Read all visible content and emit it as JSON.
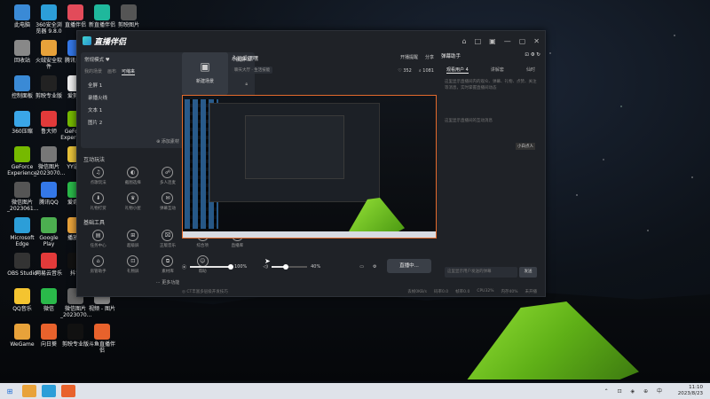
{
  "desktop": {
    "icons": [
      {
        "label": "此电脑",
        "color": "#3a8ad6"
      },
      {
        "label": "360安全浏览器 9.8.0",
        "color": "#2c9ed8"
      },
      {
        "label": "直播伴侣",
        "color": "#e24b5a"
      },
      {
        "label": "新直播伴侣",
        "color": "#1fb89c"
      },
      {
        "label": "剪映图片",
        "color": "#555"
      },
      {
        "label": "回收站",
        "color": "#888"
      },
      {
        "label": "火绒安全软件",
        "color": "#e8a23a"
      },
      {
        "label": "腾讯会议",
        "color": "#3478e8"
      },
      {
        "label": "营销图",
        "color": "#aa3366"
      },
      {
        "label": "控制面板",
        "color": "#3a8ad6"
      },
      {
        "label": "剪映专业版",
        "color": "#222"
      },
      {
        "label": "爱剪辑",
        "color": "#eee"
      },
      {
        "label": "360压缩",
        "color": "#3aa6e8"
      },
      {
        "label": "鲁大师",
        "color": "#e23a3a"
      },
      {
        "label": "GeForce Experience",
        "color": "#76b900"
      },
      {
        "label": "GeForce Experience",
        "color": "#76b900"
      },
      {
        "label": "微信图片_2023070...",
        "color": "#777"
      },
      {
        "label": "YY语音",
        "color": "#e8c23a"
      },
      {
        "label": "微信图片_2023061...",
        "color": "#555"
      },
      {
        "label": "腾讯QQ",
        "color": "#3478e8"
      },
      {
        "label": "爱奇艺",
        "color": "#2ab94a"
      },
      {
        "label": "Microsoft Edge",
        "color": "#2c9ed8"
      },
      {
        "label": "Google Play",
        "color": "#4caf50"
      },
      {
        "label": "播放器",
        "color": "#e8a23a"
      },
      {
        "label": "OBS Studio",
        "color": "#333"
      },
      {
        "label": "网易云音乐",
        "color": "#e23a3a"
      },
      {
        "label": "抖音",
        "color": "#111"
      },
      {
        "label": "QQ音乐",
        "color": "#f4c430"
      },
      {
        "label": "微信",
        "color": "#2ab94a"
      },
      {
        "label": "微信图片_2023070...",
        "color": "#666"
      },
      {
        "label": "视频 - 图片",
        "color": "#888"
      },
      {
        "label": "WeGame",
        "color": "#e8a23a"
      },
      {
        "label": "向日葵",
        "color": "#e8622c"
      },
      {
        "label": "剪映专业版",
        "color": "#111"
      },
      {
        "label": "斗鱼直播伴侣",
        "color": "#e8622c"
      }
    ]
  },
  "taskbar": {
    "time": "11:10",
    "date": "2023/8/23",
    "tray": "⌃ ⊡ ◈ ⊕ 中"
  },
  "app": {
    "title": "直播伴侣",
    "win_ctrls": [
      "⌂",
      "□",
      "▣",
      "—",
      "▢",
      "✕"
    ],
    "scene": {
      "mode": "常规模式 ♥",
      "mode_right": "横屏",
      "tabs": [
        "我的场景",
        "画布",
        "可缩来"
      ],
      "sources": [
        {
          "name": "全屏 1"
        },
        {
          "name": "录播火线"
        },
        {
          "name": "文本 1"
        },
        {
          "name": "图片 2"
        }
      ],
      "add_label": "⊕ 添加素材"
    },
    "interaction": {
      "title": "互动玩法",
      "tools": [
        {
          "icon": "♫",
          "label": "点歌玩法"
        },
        {
          "icon": "◐",
          "label": "截图选择"
        },
        {
          "icon": "☍",
          "label": "多人连麦"
        },
        {
          "icon": "◎",
          "label": "全民PK"
        },
        {
          "icon": "⊙",
          "label": ""
        },
        {
          "icon": "⬇",
          "label": "礼物打赏"
        },
        {
          "icon": "♛",
          "label": "礼物小屋"
        },
        {
          "icon": "✉",
          "label": "弹幕互动"
        },
        {
          "icon": "⊛",
          "label": "互动答题"
        },
        {
          "icon": "",
          "label": ""
        }
      ]
    },
    "basic_tools": {
      "title": "基础工具",
      "tools": [
        {
          "icon": "▤",
          "label": "任务中心"
        },
        {
          "icon": "⊞",
          "label": "超级屏"
        },
        {
          "icon": "⌧",
          "label": "正版音乐"
        },
        {
          "icon": "⬇",
          "label": "综合项"
        },
        {
          "icon": "▦",
          "label": "直播库"
        },
        {
          "icon": "⌂",
          "label": "房管助手"
        },
        {
          "icon": "⊡",
          "label": "礼物屏"
        },
        {
          "icon": "⧉",
          "label": "素材库"
        },
        {
          "icon": "☺",
          "label": "帮助"
        },
        {
          "icon": "",
          "label": ""
        }
      ],
      "more": "⋯ 更多功能"
    },
    "header": {
      "scene_thumb_label": "新建场景",
      "room_title": "永远爱嘿嘿",
      "room_sub": "聊天大厅 · 生活技能",
      "right_top": [
        "开播提醒",
        "分享"
      ],
      "right_stats": [
        "♡ 352",
        "⌕ 1081"
      ]
    },
    "controls": {
      "mic_label": "⦿",
      "mic_value": "100%",
      "mic_fill": 1.0,
      "speaker_label": "◁)",
      "speaker_value": "40%",
      "speaker_fill": 0.4,
      "live_button": "直播中..."
    },
    "status": {
      "left": "◎ CT丰富多层级开发技巧",
      "items": [
        "丢帧0KB/s",
        "码率0.0",
        "帧率0.0",
        "CPU32%",
        "内存40%",
        "未开播"
      ]
    },
    "assistant": {
      "title": "弹幕助手",
      "tabs": [
        "观看用户 4",
        "讲解套",
        "仙时"
      ],
      "text1": "这里显示直播间内的观众、弹幕、礼物、点赞、关注等消息，实时掌握直播间动态",
      "text2": "这里显示直播间的互动消息",
      "badge": "小白点人",
      "input_placeholder": "这里显示用户发送的弹幕",
      "send": "发送"
    }
  }
}
